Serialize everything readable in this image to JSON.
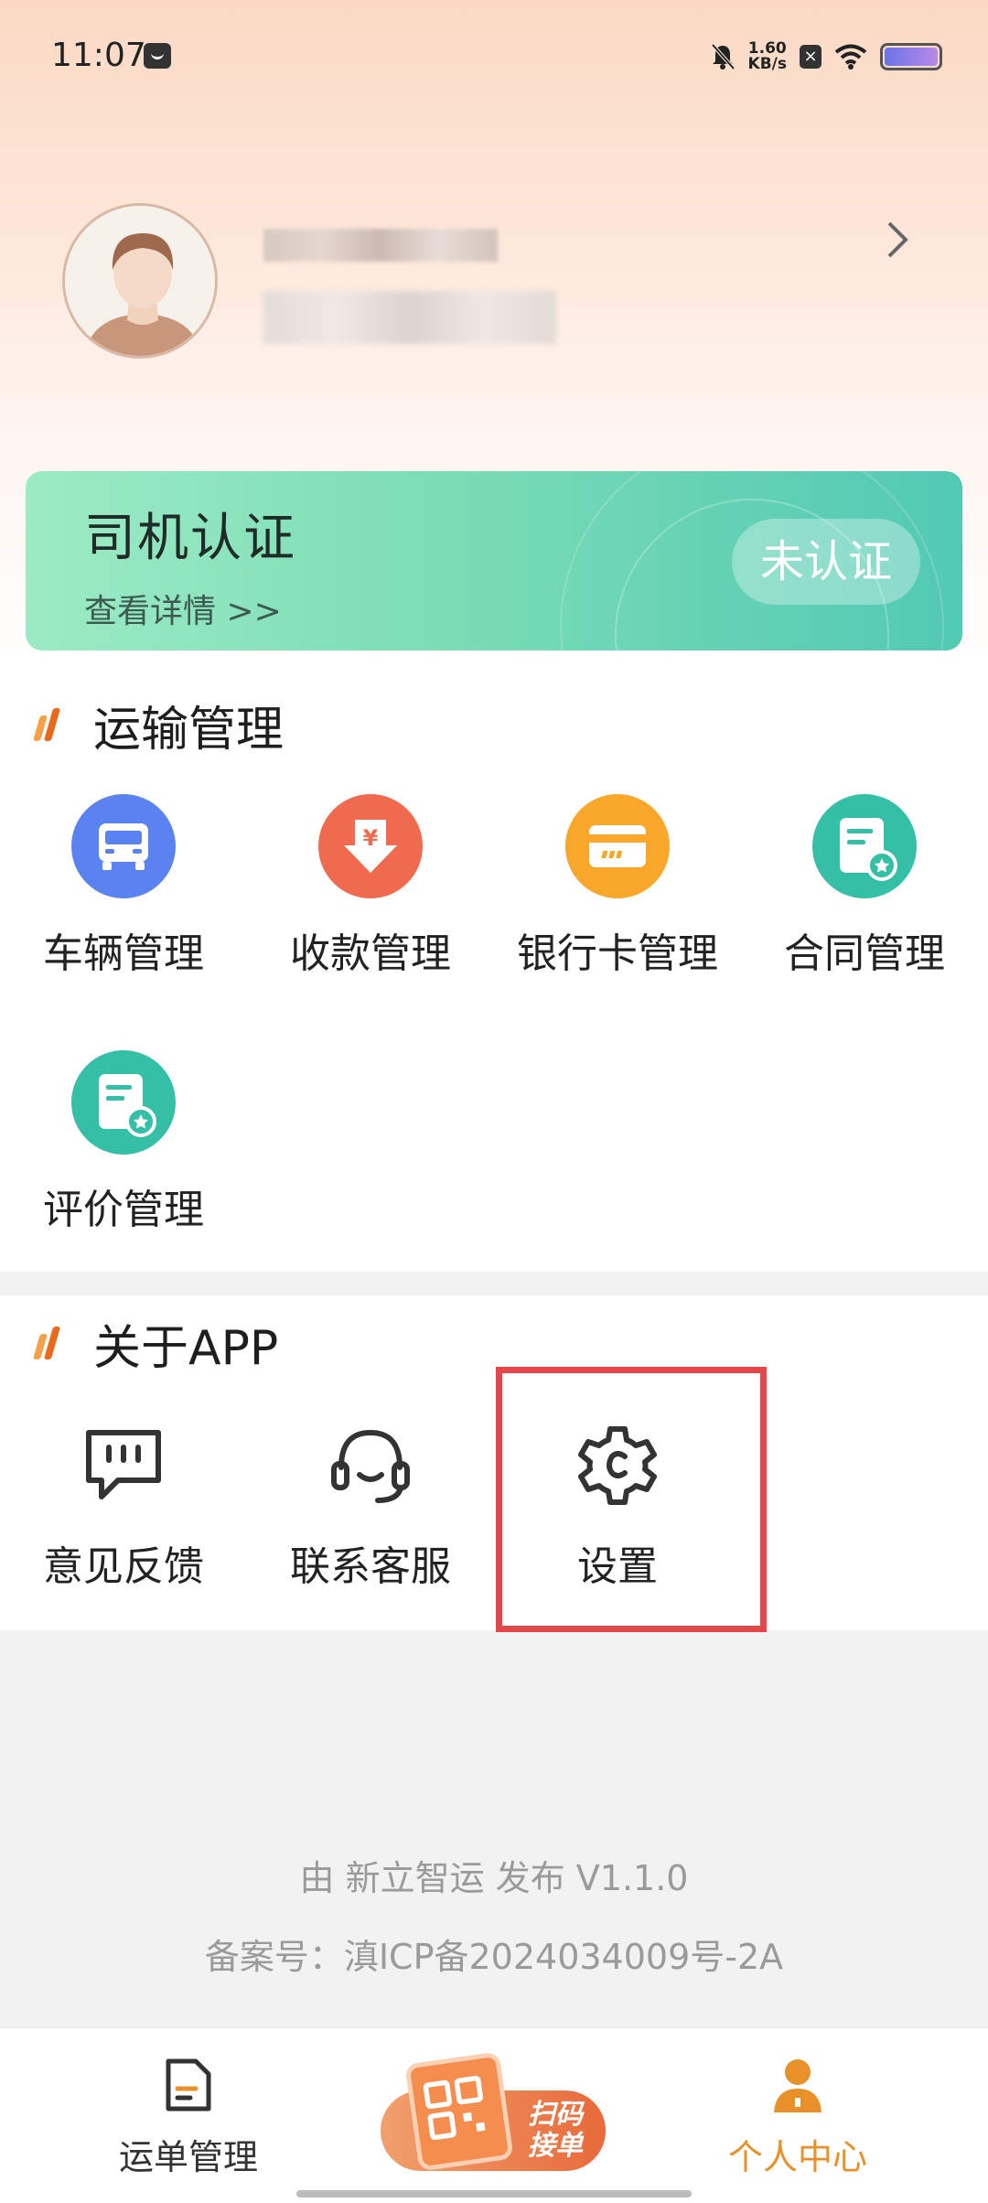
{
  "status_bar": {
    "time": "11:07",
    "network_speed_value": "1.60",
    "network_speed_unit": "KB/s"
  },
  "profile": {
    "name": "",
    "phone": ""
  },
  "certification": {
    "title": "司机认证",
    "link": "查看详情 >>",
    "status": "未认证"
  },
  "transport_section": {
    "title": "运输管理",
    "items": [
      {
        "label": "车辆管理",
        "icon": "truck-icon",
        "color": "#5b82f1"
      },
      {
        "label": "收款管理",
        "icon": "yuan-download-icon",
        "color": "#ef6a4f"
      },
      {
        "label": "银行卡管理",
        "icon": "bank-card-icon",
        "color": "#f8a72a"
      },
      {
        "label": "合同管理",
        "icon": "contract-icon",
        "color": "#34bfa6"
      },
      {
        "label": "评价管理",
        "icon": "review-icon",
        "color": "#34bfa6"
      }
    ]
  },
  "about_section": {
    "title": "关于APP",
    "items": [
      {
        "label": "意见反馈",
        "icon": "feedback-icon"
      },
      {
        "label": "联系客服",
        "icon": "headset-icon"
      },
      {
        "label": "设置",
        "icon": "gear-icon"
      }
    ]
  },
  "footer": {
    "publisher": "由 新立智运 发布  V1.1.0",
    "icp": "备案号：滇ICP备2024034009号-2A"
  },
  "bottom_nav": {
    "items": [
      {
        "label": "运单管理",
        "icon": "waybill-icon",
        "active": false
      },
      {
        "label": "扫码接单",
        "icon": "qr-scan-icon",
        "active": false
      },
      {
        "label": "个人中心",
        "icon": "person-icon",
        "active": true
      }
    ],
    "scan_text_line1": "扫码",
    "scan_text_line2": "接单"
  },
  "colors": {
    "accent_orange": "#e8912a",
    "highlight_red": "#e4474a",
    "cert_green": "#52c9b4"
  }
}
